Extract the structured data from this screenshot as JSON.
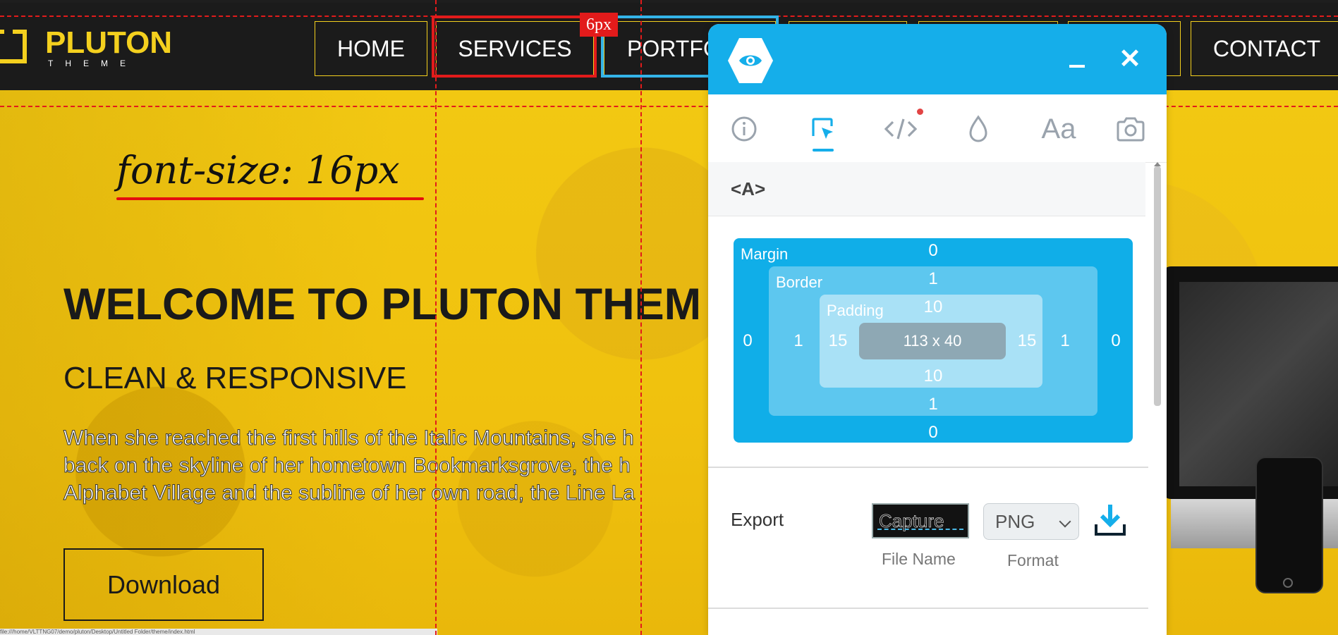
{
  "site": {
    "logo_title": "PLUTON",
    "logo_subtitle": "THEME",
    "nav": [
      "HOME",
      "SERVICES",
      "PORTFC",
      "CONTACT"
    ],
    "annotation": "font-size: 16px",
    "spacing_badge": "6px",
    "hero_title": "WELCOME TO PLUTON THEM",
    "hero_subtitle": "CLEAN & RESPONSIVE",
    "hero_paragraph_lines": [
      "When she reached the first hills of the Italic Mountains, she h",
      "back on the skyline of her hometown Bookmarksgrove, the h",
      "Alphabet Village and the subline of her own road, the Line La"
    ],
    "download_label": "Download",
    "status_url": "file:///home/VLTTNG07/demo/pluton/Desktop/Untitled Folder/theme/index.html"
  },
  "inspector": {
    "selected_tag": "<A>",
    "tabs": [
      {
        "name": "info-icon"
      },
      {
        "name": "selector-icon",
        "active": true
      },
      {
        "name": "code-icon",
        "has_notification": true
      },
      {
        "name": "color-drop-icon"
      },
      {
        "name": "typography-icon",
        "label": "Aa"
      },
      {
        "name": "camera-icon"
      }
    ],
    "box_model": {
      "margin_label": "Margin",
      "border_label": "Border",
      "padding_label": "Padding",
      "margin": {
        "top": "0",
        "right": "0",
        "bottom": "0",
        "left": "0"
      },
      "border": {
        "top": "1",
        "right": "1",
        "bottom": "1",
        "left": "1"
      },
      "padding": {
        "top": "10",
        "right": "15",
        "bottom": "10",
        "left": "15"
      },
      "content": "113 x 40"
    },
    "export": {
      "label": "Export",
      "file_name_value": "Capture",
      "file_name_caption": "File Name",
      "format_value": "PNG",
      "format_caption": "Format"
    }
  },
  "colors": {
    "brand_yellow": "#f4d01e",
    "inspector_blue": "#15aeea",
    "guide_red": "#e21b1b"
  }
}
